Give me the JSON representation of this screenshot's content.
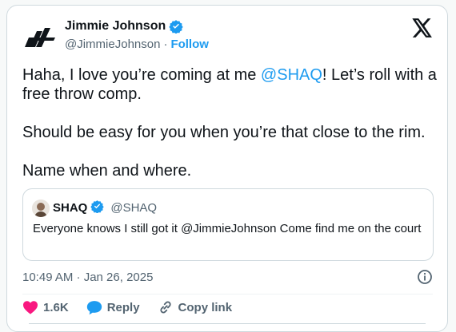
{
  "author": {
    "name": "Jimmie Johnson",
    "handle": "@JimmieJohnson",
    "separator": "·",
    "follow_label": "Follow"
  },
  "tweet": {
    "line1_before": "Haha, I love you’re coming at me ",
    "mention": "@SHAQ",
    "line1_after": "! Let’s roll with a free throw comp.",
    "paragraph2": "Should be easy for you when you’re that close to the rim.",
    "paragraph3": "Name when and where."
  },
  "quote": {
    "name": "SHAQ",
    "handle": "@SHAQ",
    "text": "Everyone knows I still got it @JimmieJohnson Come find me on the court"
  },
  "timestamp": "10:49 AM · Jan 26, 2025",
  "actions": {
    "like_count": "1.6K",
    "reply_label": "Reply",
    "copy_link_label": "Copy link"
  },
  "colors": {
    "accent": "#1d9bf0",
    "like": "#f91880",
    "text": "#0f1419",
    "muted": "#536471"
  }
}
